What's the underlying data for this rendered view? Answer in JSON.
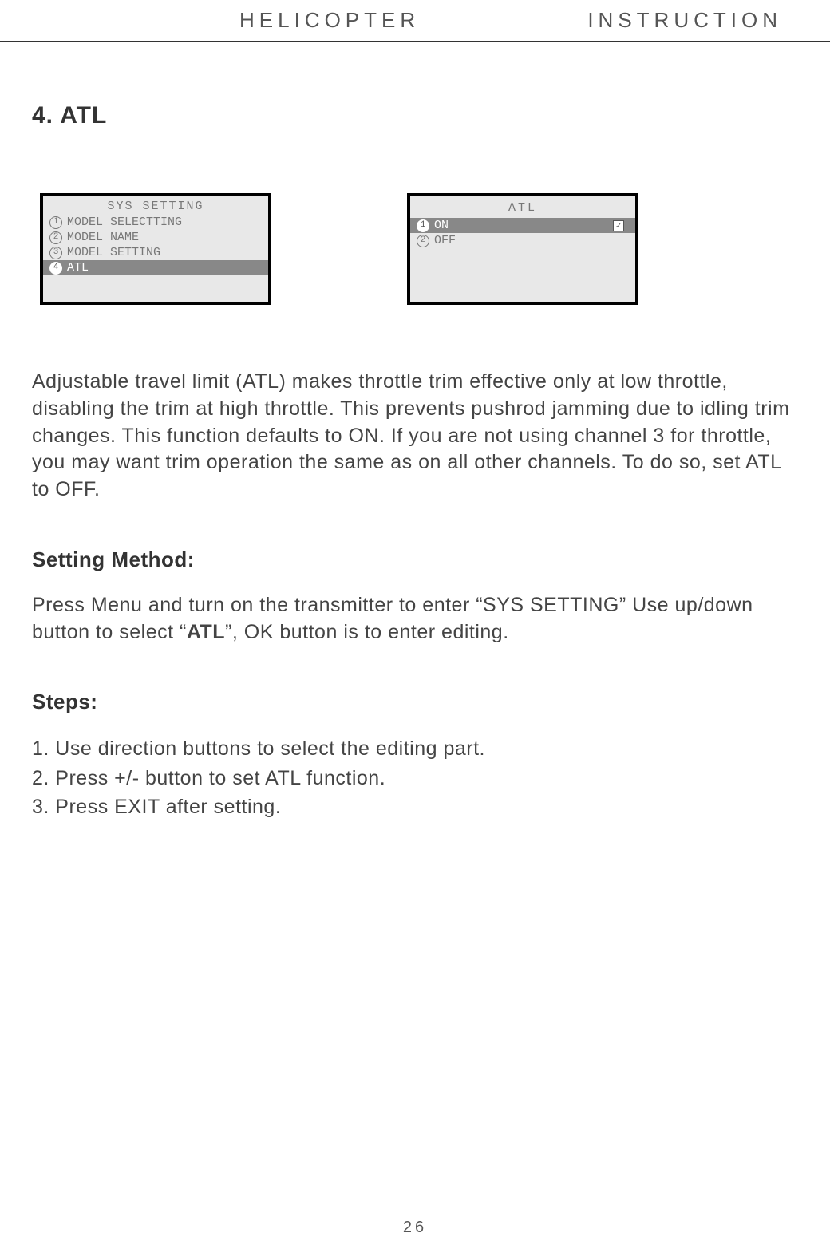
{
  "header": {
    "left": "HELICOPTER",
    "right": "INSTRUCTION"
  },
  "section_title": "4. ATL",
  "screen1": {
    "title": "SYS SETTING",
    "rows": [
      {
        "num": "1",
        "label": "MODEL SELECTTING",
        "selected": false
      },
      {
        "num": "2",
        "label": "MODEL NAME",
        "selected": false
      },
      {
        "num": "3",
        "label": "MODEL SETTING",
        "selected": false
      },
      {
        "num": "4",
        "label": "ATL",
        "selected": true
      }
    ]
  },
  "screen2": {
    "title": "ATL",
    "rows": [
      {
        "num": "1",
        "label": "ON",
        "selected": true,
        "checked": true
      },
      {
        "num": "2",
        "label": "OFF",
        "selected": false,
        "checked": false
      }
    ]
  },
  "description": "Adjustable travel limit (ATL) makes throttle trim effective only at low throttle, disabling the trim at high throttle. This prevents pushrod jamming due to idling trim changes. This function defaults to ON. If you are not using channel 3 for throttle, you may want trim operation the same as on all other channels. To do so, set ATL to OFF.",
  "setting_method_label": "Setting Method:",
  "setting_method_text_a": "Press Menu and turn on the transmitter to enter “SYS SETTING” Use up/down button to select “",
  "setting_method_bold": "ATL",
  "setting_method_text_b": "”, OK button is to enter editing.",
  "steps_label": "Steps:",
  "steps": [
    "1. Use direction buttons to select the editing part.",
    "2. Press +/- button to set ATL function.",
    "3. Press EXIT after setting."
  ],
  "page_number": "26"
}
